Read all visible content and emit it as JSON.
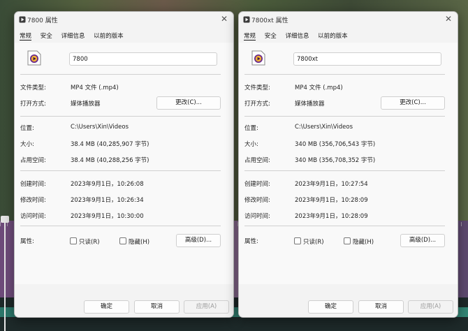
{
  "windows": [
    {
      "title": "7800 属性",
      "tabs": [
        "常规",
        "安全",
        "详细信息",
        "以前的版本"
      ],
      "file_name": "7800",
      "file_type_label": "文件类型:",
      "file_type": "MP4 文件 (.mp4)",
      "open_with_label": "打开方式:",
      "open_with": "媒体播放器",
      "change_button": "更改(C)...",
      "location_label": "位置:",
      "location": "C:\\Users\\Xin\\Videos",
      "size_label": "大小:",
      "size": "38.4 MB (40,285,907 字节)",
      "size_on_disk_label": "占用空间:",
      "size_on_disk": "38.4 MB (40,288,256 字节)",
      "created_label": "创建时间:",
      "created": "2023年9月1日，10:26:08",
      "modified_label": "修改时间:",
      "modified": "2023年9月1日，10:26:34",
      "accessed_label": "访问时间:",
      "accessed": "2023年9月1日，10:30:00",
      "attributes_label": "属性:",
      "readonly_label": "只读(R)",
      "hidden_label": "隐藏(H)",
      "advanced_button": "高级(D)...",
      "ok_button": "确定",
      "cancel_button": "取消",
      "apply_button": "应用(A)"
    },
    {
      "title": "7800xt 属性",
      "tabs": [
        "常规",
        "安全",
        "详细信息",
        "以前的版本"
      ],
      "file_name": "7800xt",
      "file_type_label": "文件类型:",
      "file_type": "MP4 文件 (.mp4)",
      "open_with_label": "打开方式:",
      "open_with": "媒体播放器",
      "change_button": "更改(C)...",
      "location_label": "位置:",
      "location": "C:\\Users\\Xin\\Videos",
      "size_label": "大小:",
      "size": "340 MB (356,706,543 字节)",
      "size_on_disk_label": "占用空间:",
      "size_on_disk": "340 MB (356,708,352 字节)",
      "created_label": "创建时间:",
      "created": "2023年9月1日，10:27:54",
      "modified_label": "修改时间:",
      "modified": "2023年9月1日，10:28:09",
      "accessed_label": "访问时间:",
      "accessed": "2023年9月1日，10:28:09",
      "attributes_label": "属性:",
      "readonly_label": "只读(R)",
      "hidden_label": "隐藏(H)",
      "advanced_button": "高级(D)...",
      "ok_button": "确定",
      "cancel_button": "取消",
      "apply_button": "应用(A)"
    }
  ],
  "icons": {
    "title_icon": "video-file-icon",
    "file_icon": "media-player-file-icon",
    "close": "close-icon"
  },
  "colors": {
    "dialog_bg": "#f3f3f3",
    "media_icon": "#6a2a8c",
    "accent_play": "#f2b233"
  }
}
